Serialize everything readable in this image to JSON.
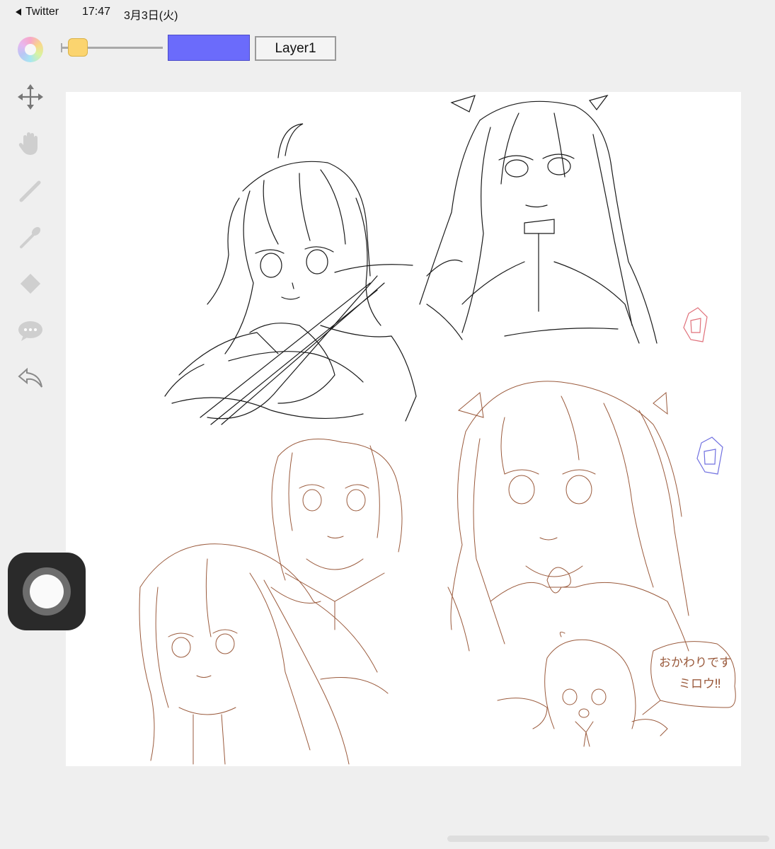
{
  "status_bar": {
    "back_label": "Twitter",
    "time": "17:47",
    "date": "3月3日(火)"
  },
  "toolbar": {
    "brush_size_fraction": 0.09,
    "current_color": "#6b6bfb",
    "layer_label": "Layer1"
  },
  "tools": [
    {
      "name": "move-tool",
      "icon": "move-arrows-icon"
    },
    {
      "name": "hand-tool",
      "icon": "hand-icon"
    },
    {
      "name": "pen-tool",
      "icon": "pen-icon"
    },
    {
      "name": "eyedropper-tool",
      "icon": "eyedropper-icon"
    },
    {
      "name": "eraser-tool",
      "icon": "eraser-icon"
    },
    {
      "name": "comment-tool",
      "icon": "speech-bubble-icon"
    },
    {
      "name": "undo-tool",
      "icon": "undo-icon"
    }
  ],
  "canvas": {
    "speech_bubble_text_line1": "おかわりです",
    "speech_bubble_text_line2": "ミロウ‼",
    "sketch_colors": {
      "black_sketch": "#1a1a1a",
      "brown_sketch": "#9a5a3c",
      "red_gem": "#e0707a",
      "blue_gem": "#7070e0"
    }
  }
}
